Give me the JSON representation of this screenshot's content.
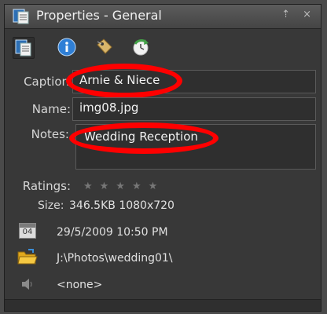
{
  "window": {
    "title": "Properties - General",
    "controls": "⇡ ×"
  },
  "toolbar": {
    "buttons": [
      {
        "icon": "general-properties-icon"
      },
      {
        "icon": "info-icon"
      },
      {
        "icon": "tag-icon"
      },
      {
        "icon": "history-icon"
      }
    ]
  },
  "caption": {
    "label": "Caption",
    "value": "Arnie & Niece"
  },
  "name": {
    "label": "Name:",
    "value": "img08.jpg"
  },
  "notes": {
    "label": "Notes:",
    "value": "Wedding Reception"
  },
  "ratings": {
    "label": "Ratings:",
    "stars": "★★★★★",
    "value": 0,
    "max": 5
  },
  "size": {
    "label": "Size:",
    "value": "346.5KB  1080x720"
  },
  "date": {
    "icon_text": "04",
    "value": "29/5/2009 10:50 PM"
  },
  "location": {
    "value": "J:\\Photos\\wedding01\\"
  },
  "audio": {
    "value": "<none>"
  },
  "colors": {
    "highlight": "#ff0000",
    "panel_bg": "#383838",
    "field_bg": "#2f2f2f"
  }
}
